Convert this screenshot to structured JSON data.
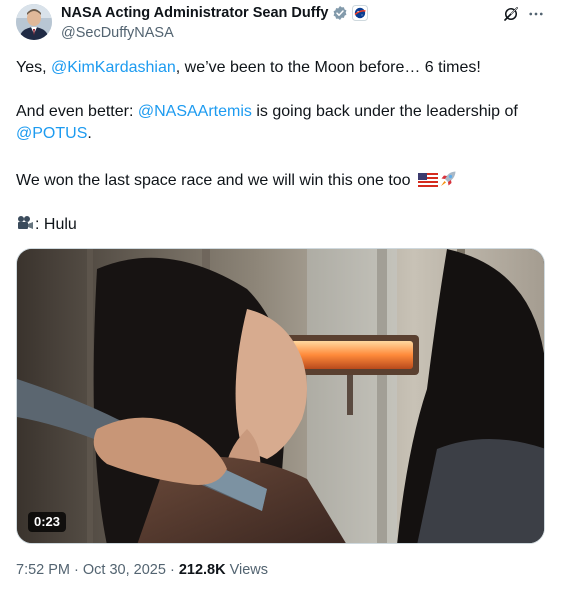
{
  "author": {
    "display_name": "NASA Acting Administrator Sean Duffy",
    "handle": "@SecDuffyNASA",
    "verified_badge_icon": "verified-badge-icon",
    "affiliation_icon": "nasa-affiliation-icon",
    "badge_color": "#829aab"
  },
  "actions": {
    "grok_icon": "grok-icon",
    "more_icon": "more-icon"
  },
  "tweet": {
    "line1_pre": "Yes, ",
    "line1_mention": "@KimKardashian",
    "line1_post": ", we’ve been to the Moon before… 6 times!",
    "line2_pre": "And even better: ",
    "line2_mention": "@NASAArtemis",
    "line2_post": " is going back under the leadership of",
    "line3_mention": "@POTUS",
    "line3_post": ".",
    "line4": "We won the last space race and we will win this one too",
    "line4_emojis": [
      "us-flag-emoji",
      "rocket-emoji"
    ],
    "credit_emoji": "movie-camera-emoji",
    "credit_text": ": Hulu"
  },
  "media": {
    "type": "video",
    "duration": "0:23"
  },
  "meta": {
    "time": "7:52 PM",
    "separator": " · ",
    "date": "Oct 30, 2025",
    "views_count": "212.8K",
    "views_label": " Views"
  },
  "colors": {
    "link": "#1d9bf0",
    "text": "#0f1419",
    "secondary": "#536471",
    "border": "#cfd9de"
  }
}
